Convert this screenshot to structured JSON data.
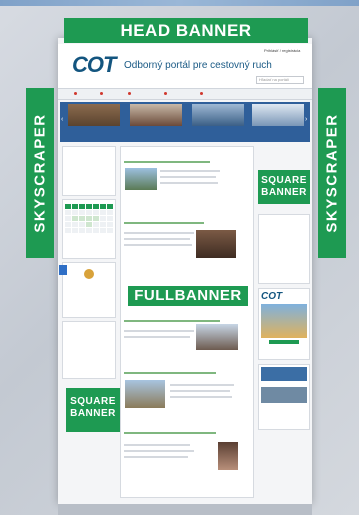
{
  "labels": {
    "head_banner": "HEAD BANNER",
    "skyscraper_left": "SKYSCRAPER",
    "skyscraper_right": "SKYSCRAPER",
    "square_banner_right": "SQUARE\nBANNER",
    "square_banner_left": "SQUARE\nBANNER",
    "full_banner": "FULLBANNER"
  },
  "site": {
    "logo": "COT",
    "tagline": "Odborný portál pre cestovný ruch",
    "user_link": "Prihlásiť / registrácia",
    "search_placeholder": "Hľadať na portáli"
  },
  "colors": {
    "banner_green": "#1e9a52",
    "brand_blue": "#13557f",
    "carousel_blue": "#2f5f9a",
    "article_title_green": "#2e8b3c"
  }
}
